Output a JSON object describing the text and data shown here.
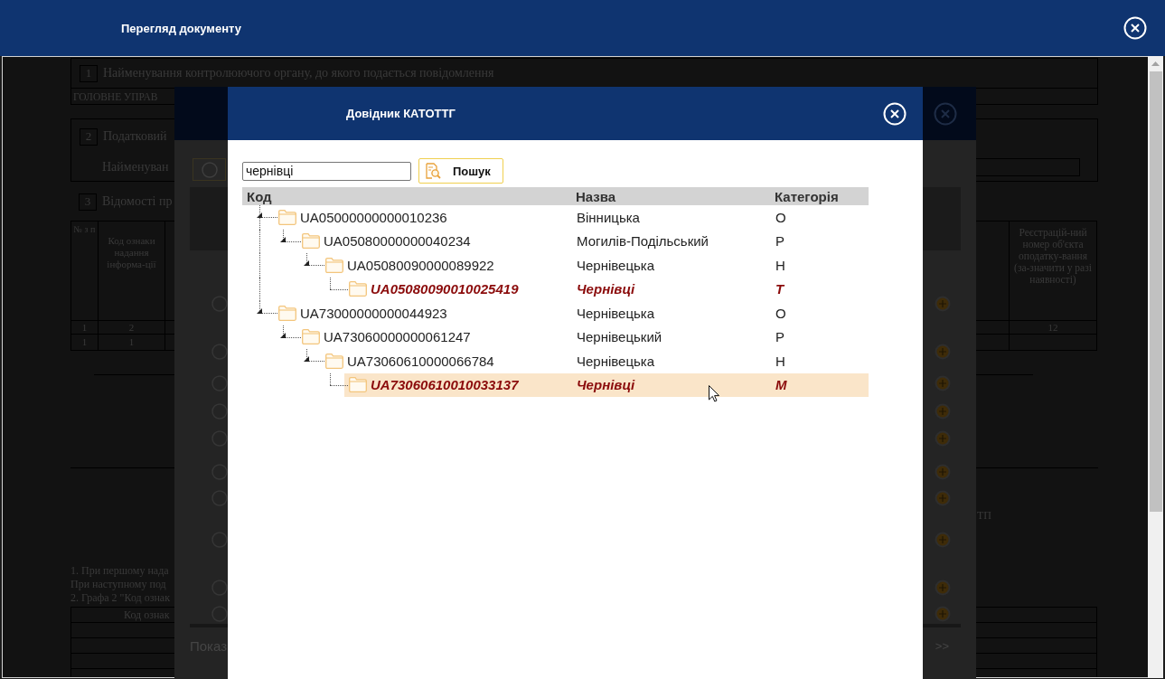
{
  "window": {
    "title": "Перегляд документу"
  },
  "document": {
    "sections": [
      {
        "number": "1",
        "title": "Найменування контролюючого органу, до якого подається повідомлення",
        "value": "ГОЛОВНЕ УПРАВ"
      },
      {
        "number": "2",
        "title": "Податковий",
        "label": "Найменуван"
      }
    ],
    "table": {
      "number": "3",
      "title": "Відомості пр",
      "columns": [
        "№ з п",
        "Код ознаки надання інформа-ції",
        "Реєстрацій-ний номер об'єкта оподатку-вання (за-значити у разі наявності)"
      ],
      "column_numbers": [
        "1",
        "2",
        "12"
      ],
      "rows": [
        [
          "1",
          "1"
        ]
      ]
    },
    "marker": "ТП",
    "notes": [
      "1. При першому нада",
      "При наступному под",
      "2. Графа 2 \"Код ознак"
    ],
    "table_2": {
      "columns": [
        "Код ознак"
      ]
    }
  },
  "background_dialog": {
    "pager_label": "Показ",
    "next_page": ">>"
  },
  "dialog": {
    "title": "Довідник КАТОТТГ",
    "search": {
      "value": "чернівці"
    },
    "search_button": "Пошук",
    "columns": [
      "Код",
      "Назва",
      "Категорія"
    ],
    "tree": [
      {
        "code": "UA05000000000010236",
        "name": "Вінницька",
        "category": "О",
        "matched": false,
        "selected": false,
        "children": [
          {
            "code": "UA05080000000040234",
            "name": "Могилів-Подільський",
            "category": "Р",
            "matched": false,
            "selected": false,
            "children": [
              {
                "code": "UA05080090000089922",
                "name": "Чернівецька",
                "category": "Н",
                "matched": false,
                "selected": false,
                "children": [
                  {
                    "code": "UA05080090010025419",
                    "name": "Чернівці",
                    "category": "Т",
                    "matched": true,
                    "selected": false
                  }
                ]
              }
            ]
          }
        ]
      },
      {
        "code": "UA73000000000044923",
        "name": "Чернівецька",
        "category": "О",
        "matched": false,
        "selected": false,
        "children": [
          {
            "code": "UA73060000000061247",
            "name": "Чернівецький",
            "category": "Р",
            "matched": false,
            "selected": false,
            "children": [
              {
                "code": "UA73060610000066784",
                "name": "Чернівецька",
                "category": "Н",
                "matched": false,
                "selected": false,
                "children": [
                  {
                    "code": "UA73060610010033137",
                    "name": "Чернівці",
                    "category": "М",
                    "matched": true,
                    "selected": true
                  }
                ]
              }
            ]
          }
        ]
      }
    ]
  }
}
